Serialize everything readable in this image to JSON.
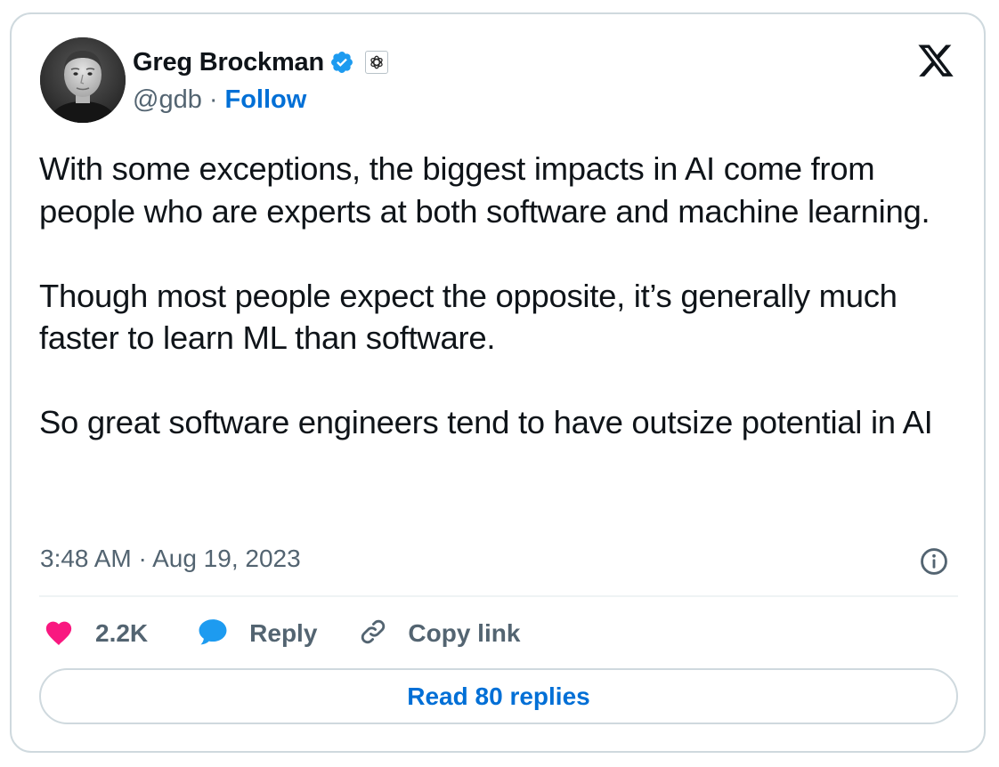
{
  "author": {
    "name": "Greg Brockman",
    "handle": "@gdb",
    "separator": "·",
    "follow_label": "Follow",
    "avatar_icon": "profile-photo",
    "verified_icon": "verified-badge-icon",
    "affiliation_icon": "openai-logo-icon"
  },
  "header": {
    "logo_icon": "x-logo-icon"
  },
  "tweet": {
    "paragraphs": [
      "With some exceptions, the biggest impacts in AI come from people who are experts at both software and machine learning.",
      "Though most people expect the opposite, it’s generally much faster to learn ML than software.",
      "So great software engineers tend to have outsize potential in AI"
    ],
    "timestamp": "3:48 AM · Aug 19, 2023",
    "info_icon": "info-icon"
  },
  "actions": {
    "like_count": "2.2K",
    "reply_label": "Reply",
    "copy_link_label": "Copy link",
    "read_replies_label": "Read 80 replies"
  },
  "colors": {
    "accent": "#006fd6",
    "verified": "#1d9bf0",
    "like": "#f91880",
    "secondary_text": "#536471",
    "border": "#cfd9de"
  }
}
